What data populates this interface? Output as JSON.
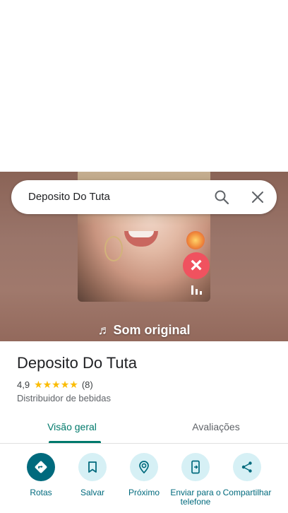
{
  "search": {
    "query": "Deposito Do Tuta"
  },
  "photo": {
    "sound_label": "Som original"
  },
  "place": {
    "name": "Deposito Do Tuta",
    "rating": "4,9",
    "stars": "★★★★★",
    "review_count": "(8)",
    "category": "Distribuidor de bebidas"
  },
  "tabs": [
    {
      "label": "Visão geral",
      "active": true
    },
    {
      "label": "Avaliações",
      "active": false
    }
  ],
  "actions": [
    {
      "label": "Rotas",
      "icon": "directions-icon"
    },
    {
      "label": "Salvar",
      "icon": "bookmark-icon"
    },
    {
      "label": "Próximo",
      "icon": "nearby-icon"
    },
    {
      "label": "Enviar para o telefone",
      "icon": "send-to-phone-icon"
    },
    {
      "label": "Compartilhar",
      "icon": "share-icon"
    }
  ],
  "colors": {
    "accent": "#006a7d",
    "tab_active": "#00796b",
    "star": "#fbbc04",
    "action_bg": "#d6f0f5"
  }
}
